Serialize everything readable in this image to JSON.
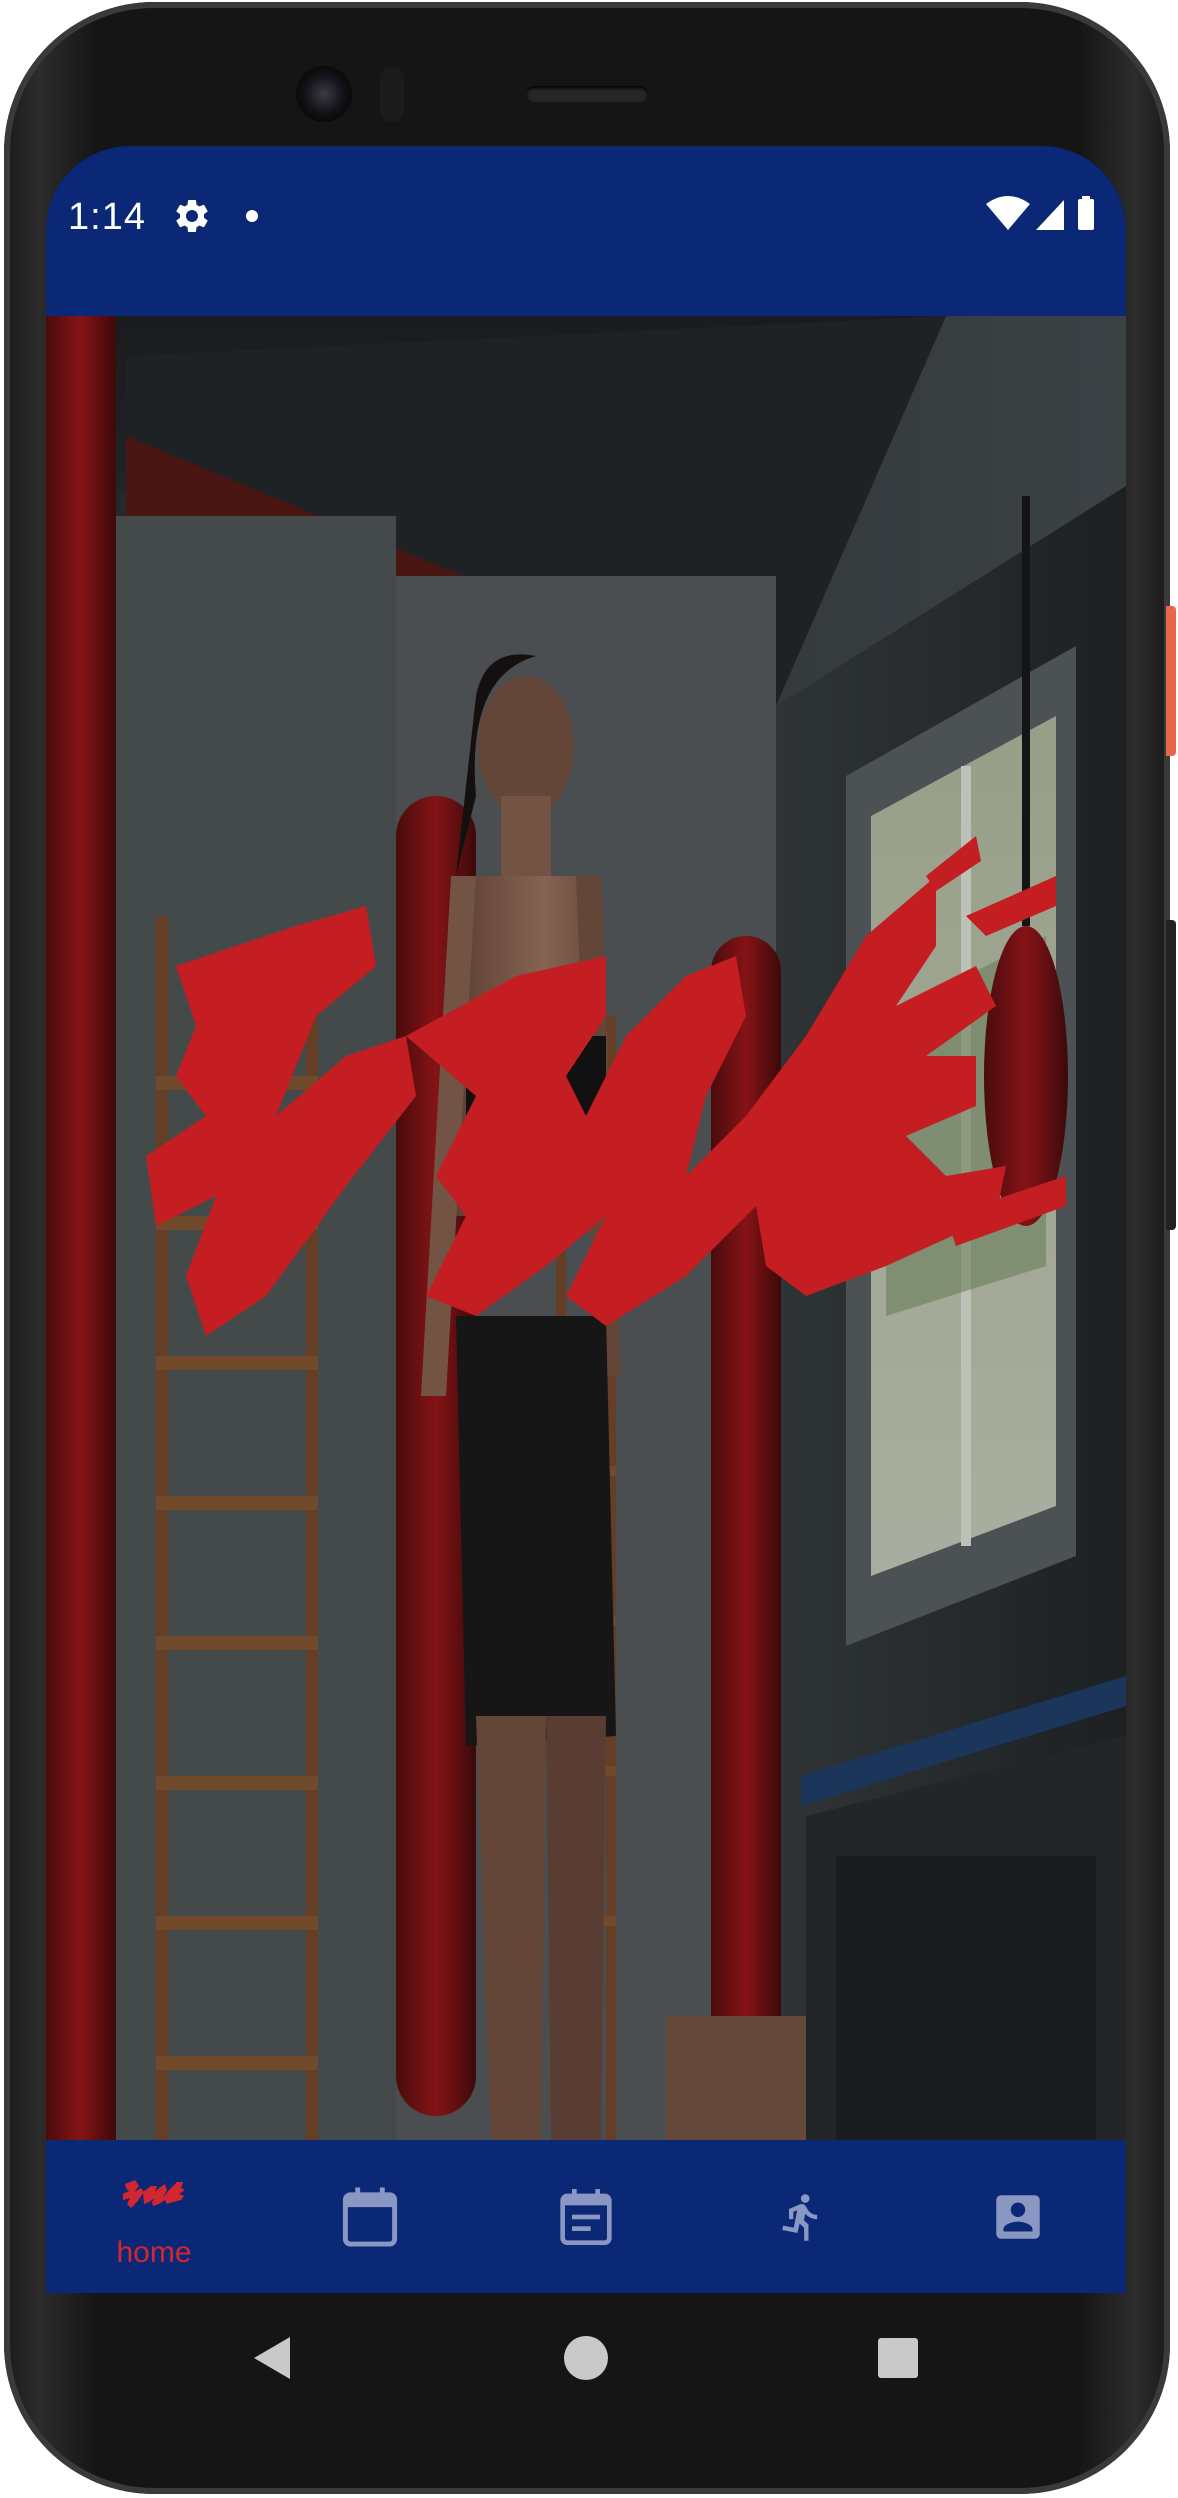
{
  "status_bar": {
    "time": "1:14",
    "icons": [
      "gear-icon",
      "notification-dot",
      "wifi-icon",
      "signal-icon",
      "battery-icon"
    ],
    "background": "#0b2877"
  },
  "hero": {
    "description_icon": "bme-logo",
    "logo_color": "#c41e22"
  },
  "bottom_nav": {
    "background": "#0b2877",
    "active_color": "#d22630",
    "inactive_color": "#8a97c2",
    "items": [
      {
        "label": "home",
        "icon": "bme-logo-icon",
        "active": true
      },
      {
        "label": "",
        "icon": "calendar-icon",
        "active": false
      },
      {
        "label": "",
        "icon": "event-note-icon",
        "active": false
      },
      {
        "label": "",
        "icon": "running-icon",
        "active": false
      },
      {
        "label": "",
        "icon": "account-box-icon",
        "active": false
      }
    ]
  },
  "system_nav": {
    "buttons": [
      "back-icon",
      "home-icon",
      "recents-icon"
    ]
  }
}
